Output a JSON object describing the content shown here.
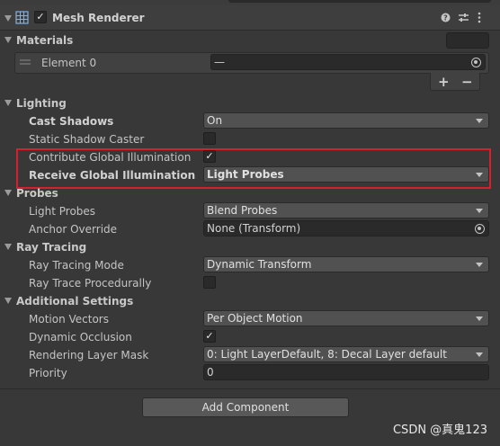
{
  "component": {
    "title": "Mesh Renderer",
    "enabled_check": "✓",
    "help_icon": "help-icon",
    "preset_icon": "preset-icon",
    "menu_icon": "kebab-menu-icon"
  },
  "materials": {
    "section": "Materials",
    "count_value": "",
    "element_label": "Element 0",
    "element_value": "—",
    "add_label": "+",
    "remove_label": "−"
  },
  "lighting": {
    "section": "Lighting",
    "cast_shadows_label": "Cast Shadows",
    "cast_shadows_value": "On",
    "static_shadow_label": "Static Shadow Caster",
    "contribute_gi_label": "Contribute Global Illumination",
    "contribute_gi_check": "✓",
    "receive_gi_label": "Receive Global Illumination",
    "receive_gi_value": "Light Probes"
  },
  "probes": {
    "section": "Probes",
    "light_probes_label": "Light Probes",
    "light_probes_value": "Blend Probes",
    "anchor_label": "Anchor Override",
    "anchor_value": "None (Transform)"
  },
  "ray_tracing": {
    "section": "Ray Tracing",
    "mode_label": "Ray Tracing Mode",
    "mode_value": "Dynamic Transform",
    "procedural_label": "Ray Trace Procedurally"
  },
  "additional": {
    "section": "Additional Settings",
    "motion_label": "Motion Vectors",
    "motion_value": "Per Object Motion",
    "occlusion_label": "Dynamic Occlusion",
    "occlusion_check": "✓",
    "layer_mask_label": "Rendering Layer Mask",
    "layer_mask_value": "0: Light LayerDefault, 8: Decal Layer default",
    "priority_label": "Priority",
    "priority_value": "0"
  },
  "add_component_label": "Add Component",
  "watermark": "CSDN @真鬼123"
}
